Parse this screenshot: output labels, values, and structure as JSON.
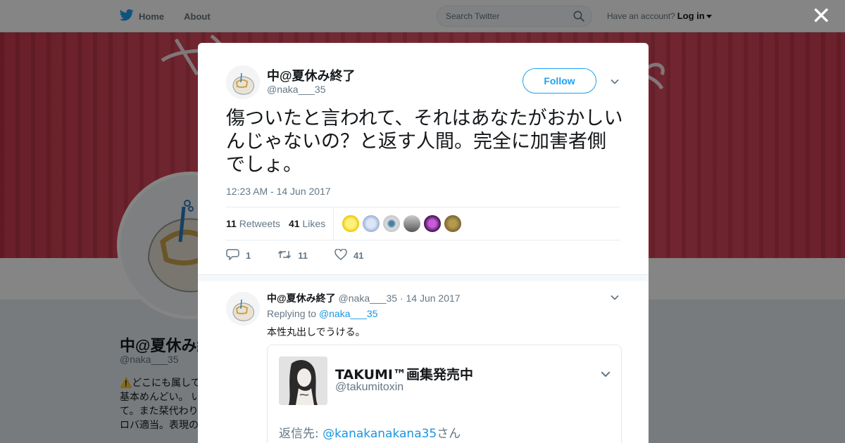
{
  "topnav": {
    "home": "Home",
    "about": "About",
    "search_placeholder": "Search Twitter",
    "have_account": "Have an account?",
    "login": "Log in"
  },
  "profile": {
    "name": "中@夏休み終了",
    "handle": "@naka___35",
    "bio_lines": [
      "⚠️どこにも属して",
      "基本めんどい。 い",
      "て。また栞代わり",
      "ロバ適当。表現の"
    ]
  },
  "tweet": {
    "author_name": "中@夏休み終了",
    "author_handle": "@naka___35",
    "follow_label": "Follow",
    "text": "傷ついたと言われて、それはあなたがおかしいんじゃないの？と返す人間。完全に加害者側でしょ。",
    "timestamp": "12:23 AM - 14 Jun 2017",
    "retweets_count": "11",
    "retweets_label": "Retweets",
    "likes_count": "41",
    "likes_label": "Likes",
    "reply_count": "1",
    "retweet_count": "11",
    "like_count": "41"
  },
  "reply": {
    "author_name": "中@夏休み終了",
    "author_handle": "@naka___35",
    "date": "· 14 Jun 2017",
    "replying_prefix": "Replying to",
    "replying_to": "@naka___35",
    "text": "本性丸出しでうける。",
    "embed": {
      "name": "TAKUMI™画集発売中",
      "handle": "@takumitoxin",
      "reply_prefix": "返信先: ",
      "reply_to": "@kanakanakana35",
      "reply_suffix": "さん"
    }
  },
  "colors": {
    "brand": "#1da1f2",
    "link": "#1b95e0",
    "banner": "#d8475a",
    "muted": "#657786"
  },
  "icons": [
    "twitter-bird-icon",
    "home-label",
    "search-icon",
    "close-icon",
    "chevron-down-icon",
    "reply-icon",
    "retweet-icon",
    "heart-icon"
  ]
}
